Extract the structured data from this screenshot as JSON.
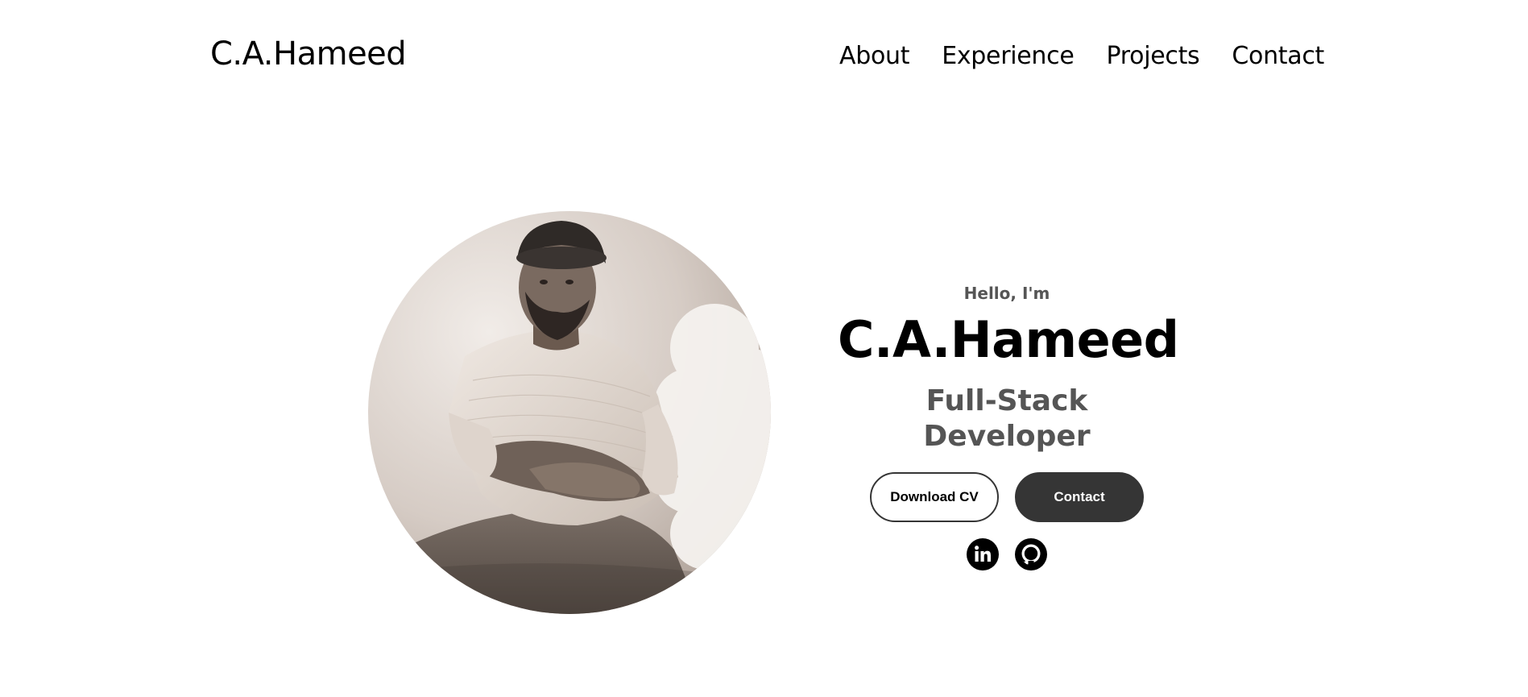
{
  "header": {
    "logo": "C.A.Hameed",
    "nav": [
      {
        "label": "About"
      },
      {
        "label": "Experience"
      },
      {
        "label": "Projects"
      },
      {
        "label": "Contact"
      }
    ]
  },
  "hero": {
    "greeting": "Hello, I'm",
    "name": "C.A.Hameed",
    "role": "Full-Stack Developer",
    "buttons": {
      "download_cv": "Download CV",
      "contact": "Contact"
    },
    "social": [
      {
        "icon": "linkedin-icon"
      },
      {
        "icon": "github-icon"
      }
    ],
    "portrait_alt": "Profile picture"
  },
  "colors": {
    "text_primary": "#000000",
    "text_secondary": "#555555",
    "button_dark": "#353535",
    "background": "#ffffff",
    "photo_tone": "#b8ada5"
  }
}
